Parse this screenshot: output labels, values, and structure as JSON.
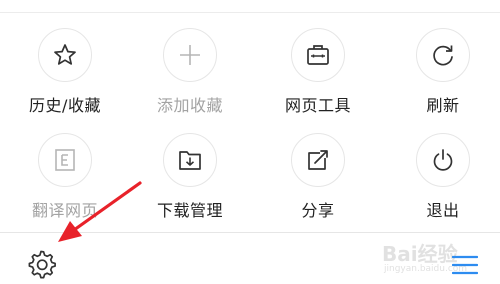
{
  "menu": {
    "items": [
      {
        "label": "历史/收藏",
        "icon": "star-icon",
        "enabled": true
      },
      {
        "label": "添加收藏",
        "icon": "plus-icon",
        "enabled": false
      },
      {
        "label": "网页工具",
        "icon": "toolbox-icon",
        "enabled": true
      },
      {
        "label": "刷新",
        "icon": "refresh-icon",
        "enabled": true
      },
      {
        "label": "翻译网页",
        "icon": "translate-icon",
        "enabled": false
      },
      {
        "label": "下载管理",
        "icon": "download-icon",
        "enabled": true
      },
      {
        "label": "分享",
        "icon": "share-icon",
        "enabled": true
      },
      {
        "label": "退出",
        "icon": "power-icon",
        "enabled": true
      }
    ]
  },
  "bottom_bar": {
    "settings_icon": "gear-icon",
    "menu_icon": "hamburger-menu-icon"
  },
  "annotation": {
    "arrow_color": "#e8222a"
  },
  "watermark": {
    "brand": "Bai经验",
    "url": "jingyan.baidu.com"
  },
  "colors": {
    "enabled_text": "#222222",
    "disabled_text": "#a3a3a3",
    "icon_stroke": "#333333",
    "accent_blue": "#2d8cf0"
  }
}
